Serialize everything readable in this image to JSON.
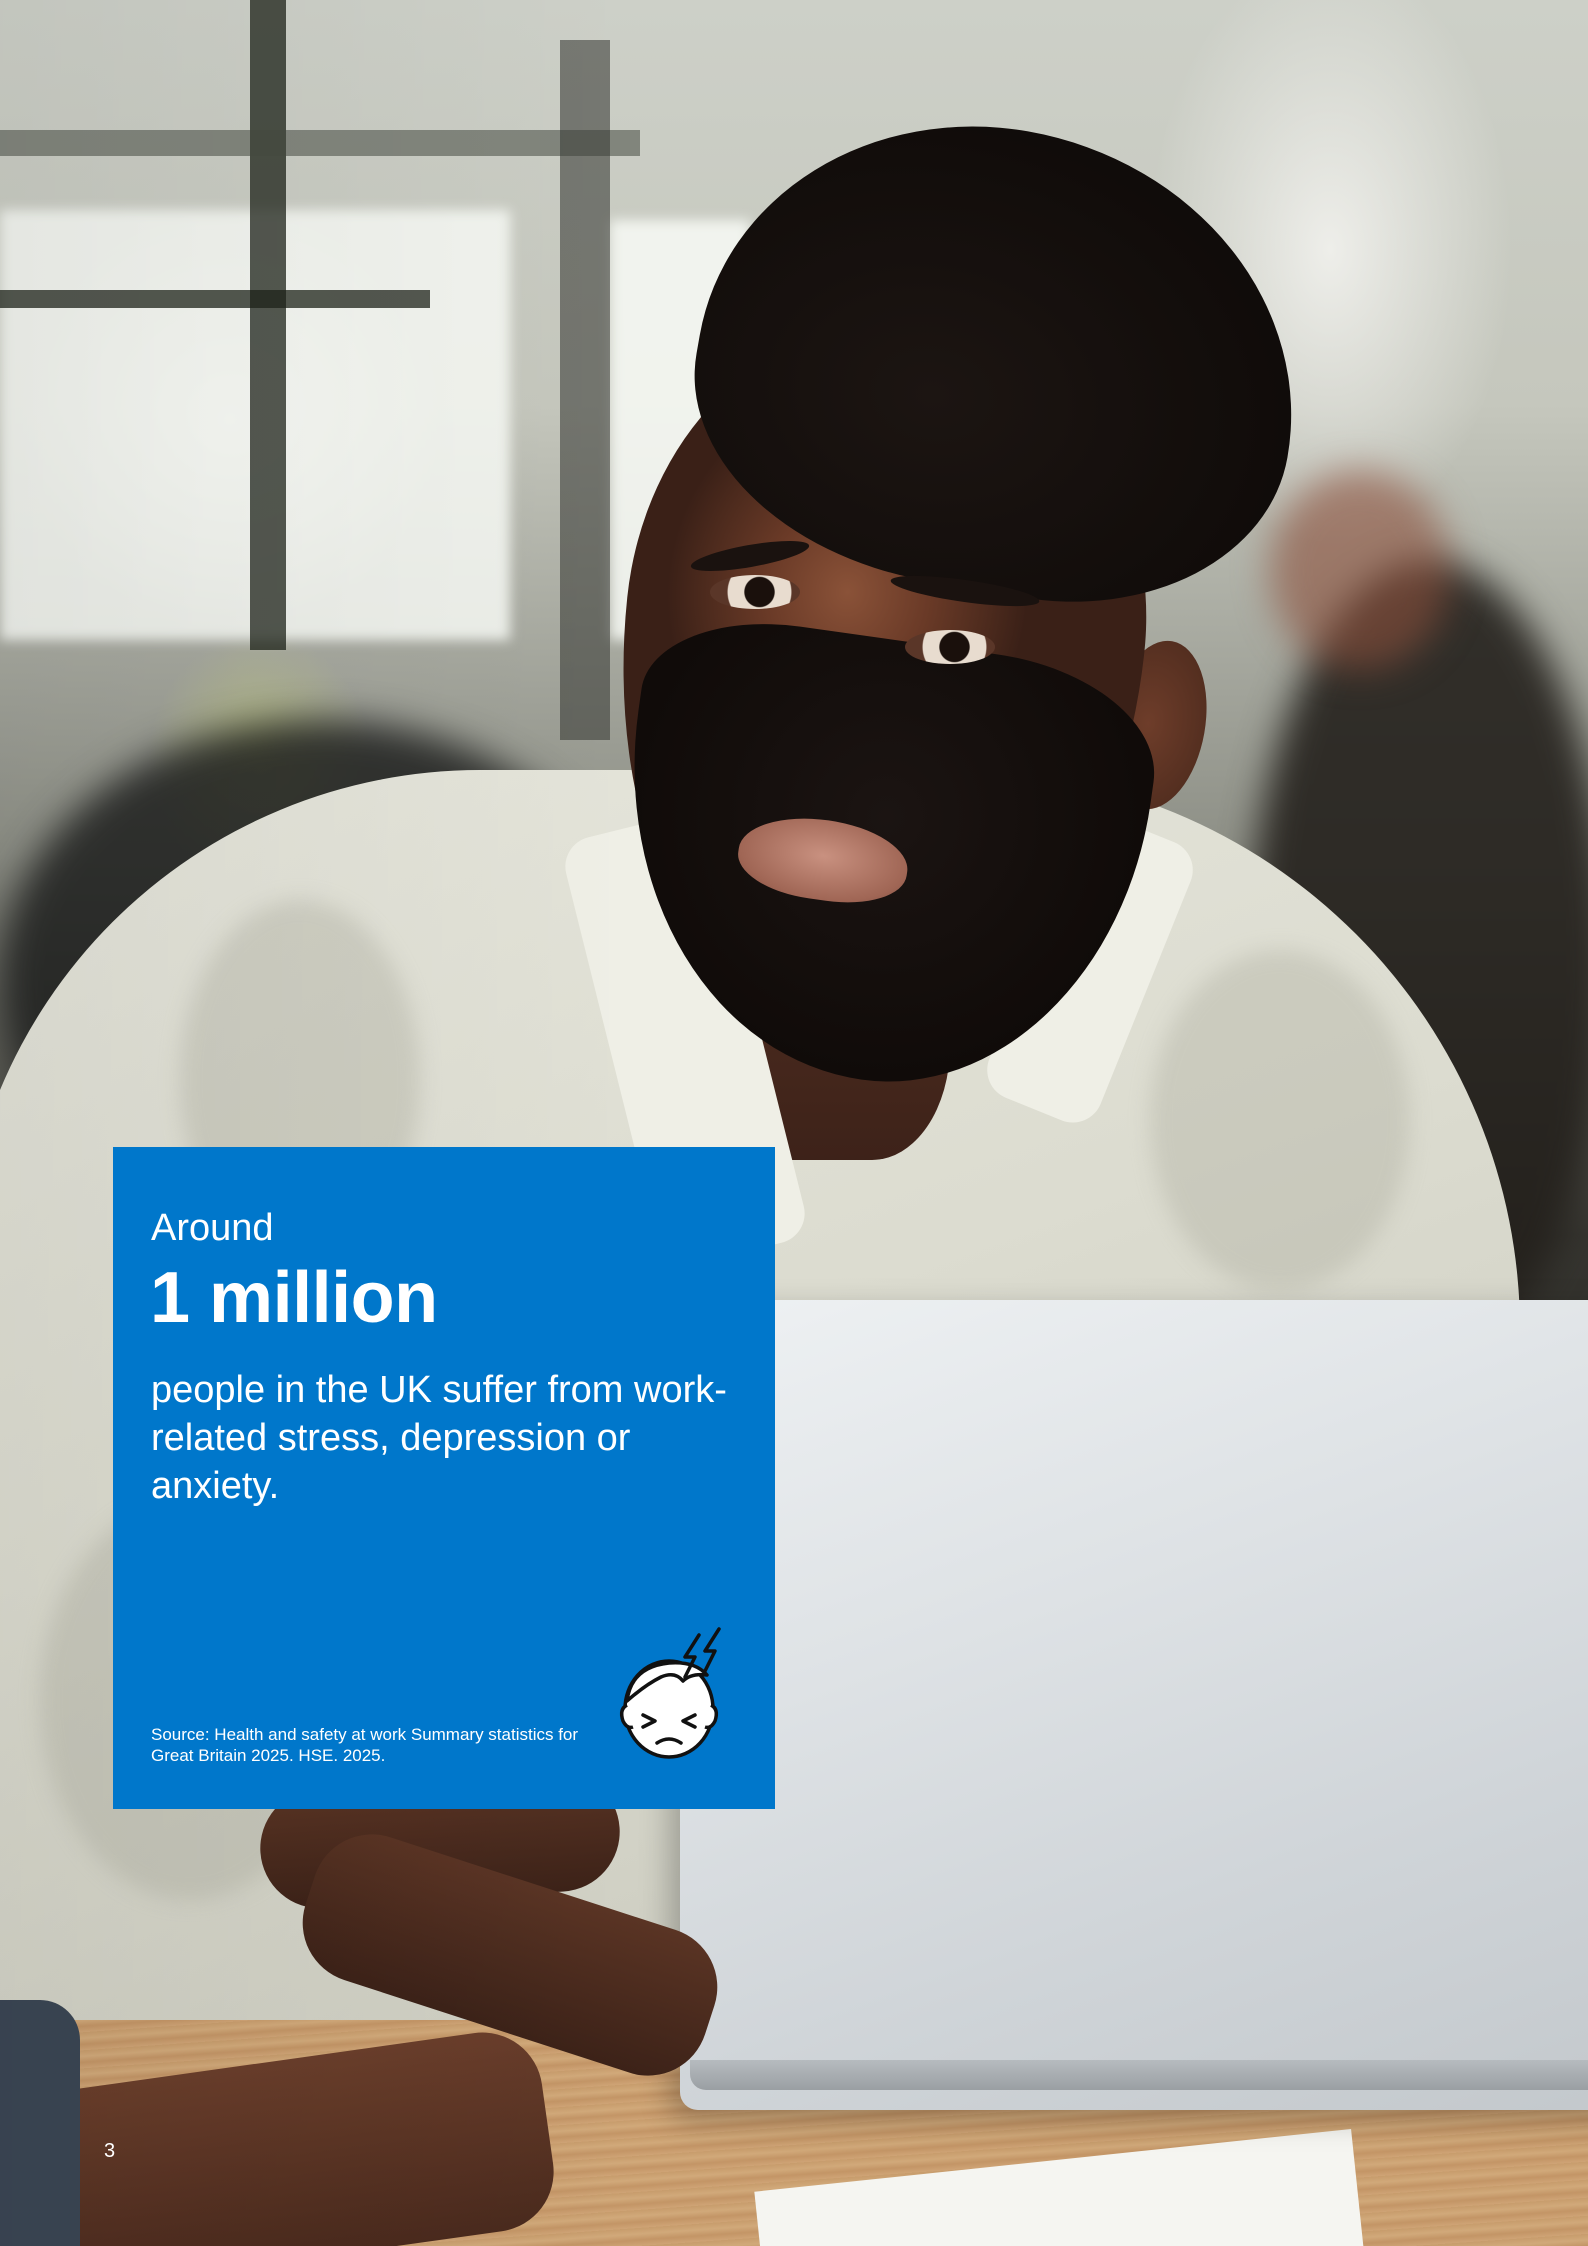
{
  "stat_card": {
    "lead": "Around",
    "figure": "1 million",
    "text": "people in the UK suffer from work-related stress, depression or anxiety.",
    "source": "Source: Health and safety at work Summary statistics for Great Britain 2025. HSE. 2025.",
    "icon": "stressed-face-icon",
    "background_color": "#0077cb",
    "text_color": "#ffffff"
  },
  "page": {
    "number": "3"
  },
  "photo": {
    "subject": "man-at-laptop-photo"
  }
}
